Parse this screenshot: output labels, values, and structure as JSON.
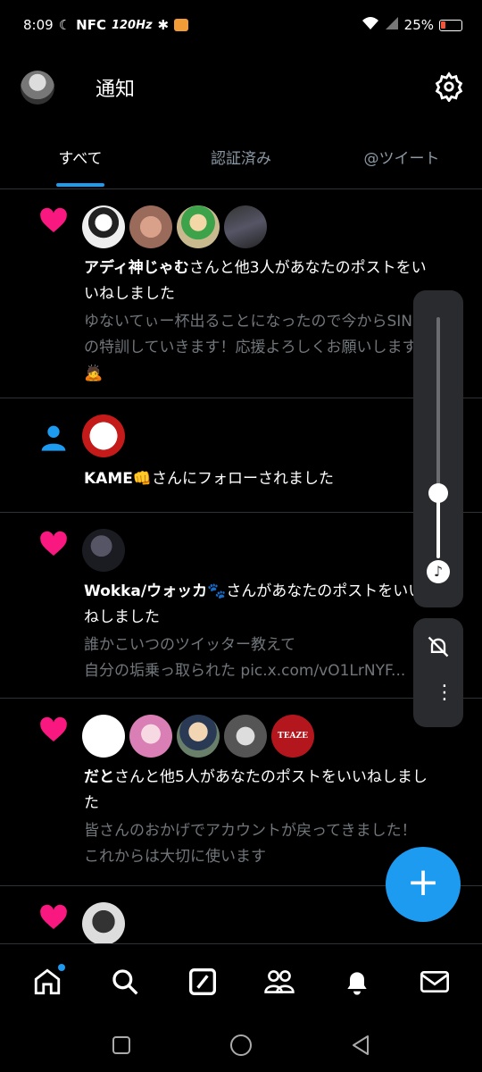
{
  "status_bar": {
    "time": "8:09",
    "nfc": "NFC",
    "refresh_rate": "120Hz",
    "battery": "25%",
    "battery_level": 0.25
  },
  "header": {
    "title": "通知",
    "settings_icon": "gear-icon"
  },
  "tabs": [
    {
      "label": "すべて",
      "active": true
    },
    {
      "label": "認証済み",
      "active": false
    },
    {
      "label": "@ツイート",
      "active": false
    }
  ],
  "notifications": [
    {
      "type": "like",
      "actor": "アディ神じゃむ",
      "text_line1_rest": "さんと他3人があなたのポストをい",
      "text_line2": "いねしました",
      "post_line1": "ゆないてぃー杯出ることになったので今からSING",
      "post_line2": "の特訓していきます！応援よろしくお願いします",
      "post_line3": "🙇"
    },
    {
      "type": "follow",
      "actor": "KAME👊",
      "text_rest": "さんにフォローされました"
    },
    {
      "type": "like",
      "actor": "Wokka/ウォッカ🐾",
      "text_line1_rest": "さんがあなたのポストをいい",
      "text_line2": "ねしました",
      "post_line1": "誰かこいつのツイッター教えて",
      "post_line2": "自分の垢乗っ取られた pic.x.com/vO1LrNYF..."
    },
    {
      "type": "like",
      "actor": "だと",
      "text_line1_rest": "さんと他5人があなたのポストをいいねしまし",
      "text_line2": "た",
      "post_line1": "皆さんのおかげでアカウントが戻ってきました！",
      "post_line2": "これからは大切に使います",
      "avatar_badge": "TEAZE"
    },
    {
      "type": "like"
    }
  ],
  "volume": {
    "level": 0.27
  },
  "fab": {
    "label": "+"
  },
  "bottom_nav": [
    "home-icon",
    "search-icon",
    "compose-icon",
    "communities-icon",
    "bell-icon",
    "mail-icon"
  ],
  "colors": {
    "accent": "#1d9bf0",
    "like": "#f91880",
    "background": "#000000"
  }
}
